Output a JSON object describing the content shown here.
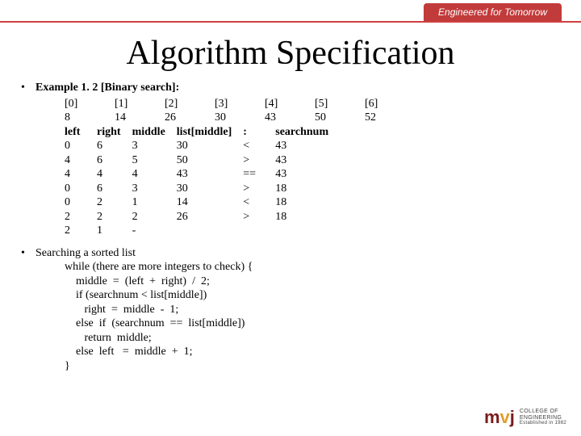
{
  "header": {
    "tagline": "Engineered for Tomorrow"
  },
  "title": "Algorithm Specification",
  "example": {
    "label": "Example 1. 2 [Binary search]:",
    "indexRow": [
      "[0]",
      "[1]",
      "[2]",
      "[3]",
      "[4]",
      "[5]",
      "[6]"
    ],
    "valueRow": [
      "8",
      "14",
      "26",
      "30",
      "43",
      "50",
      "52"
    ],
    "traceHeaders": [
      "left",
      "right",
      "middle",
      "list[middle]",
      ":",
      "searchnum"
    ],
    "traceRows": [
      [
        "0",
        "6",
        "3",
        "30",
        "<",
        "43"
      ],
      [
        "4",
        "6",
        "5",
        "50",
        ">",
        "43"
      ],
      [
        "4",
        "4",
        "4",
        "43",
        "==",
        "43"
      ],
      [
        "0",
        "6",
        "3",
        "30",
        ">",
        "18"
      ],
      [
        "0",
        "2",
        "1",
        "14",
        "<",
        "18"
      ],
      [
        "2",
        "2",
        "2",
        "26",
        ">",
        "18"
      ],
      [
        "2",
        "1",
        "-",
        "",
        "",
        ""
      ]
    ]
  },
  "search": {
    "heading": "Searching a sorted list",
    "code": "while (there are more integers to check) {\n    middle  =  (left  +  right)  /  2;\n    if (searchnum < list[middle])\n       right  =  middle  -  1;\n    else  if  (searchnum  ==  list[middle])\n       return  middle;\n    else  left   =  middle  +  1;\n}"
  },
  "logo": {
    "mark_m": "m",
    "mark_v": "v",
    "mark_j": "j",
    "line1": "COLLEGE OF",
    "line2": "ENGINEERING",
    "line3": "Established in 1982"
  }
}
